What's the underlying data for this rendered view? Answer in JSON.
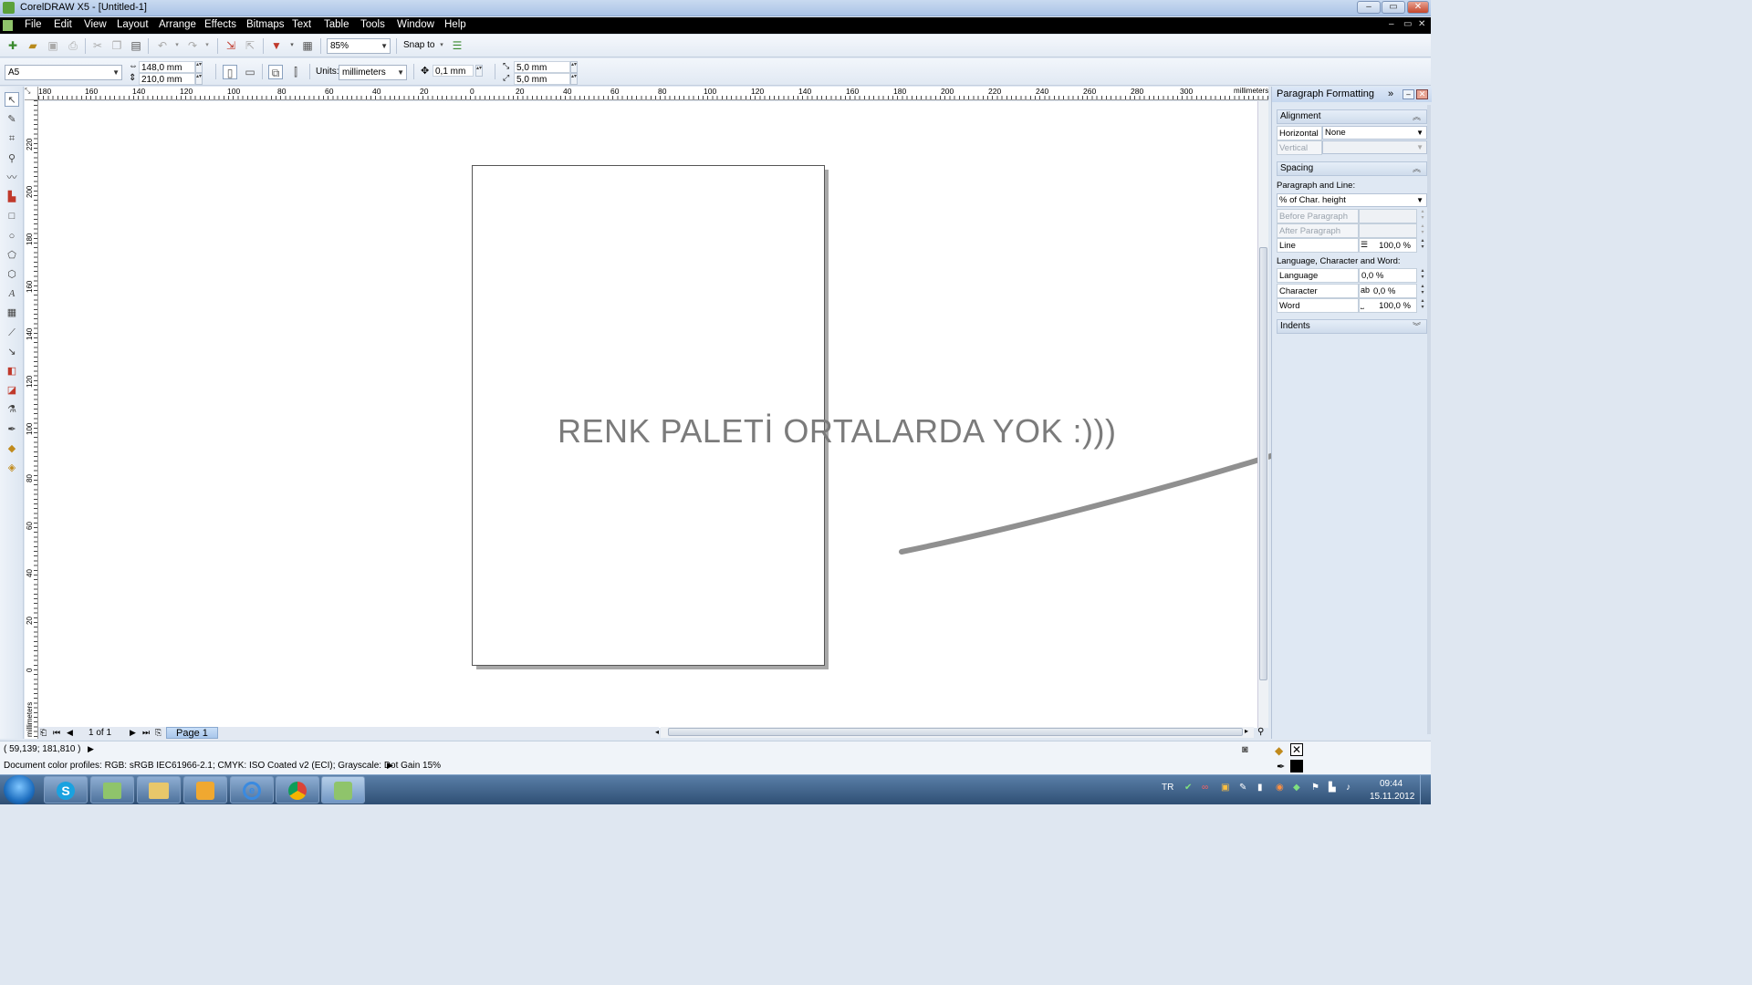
{
  "window": {
    "title": "CorelDRAW X5 - [Untitled-1]",
    "min": "–",
    "max": "▭",
    "close": "✕"
  },
  "menu": [
    "File",
    "Edit",
    "View",
    "Layout",
    "Arrange",
    "Effects",
    "Bitmaps",
    "Text",
    "Table",
    "Tools",
    "Window",
    "Help"
  ],
  "toolbar": {
    "zoom": "85%",
    "snap": "Snap to"
  },
  "property_bar": {
    "paper": "A5",
    "width": "148,0 mm",
    "height": "210,0 mm",
    "units_label": "Units:",
    "units": "millimeters",
    "nudge": "0,1 mm",
    "dup_x": "5,0 mm",
    "dup_y": "5,0 mm"
  },
  "ruler": {
    "h_labels": [
      "180",
      "160",
      "140",
      "120",
      "100",
      "80",
      "60",
      "40",
      "20",
      "0",
      "20",
      "40",
      "60",
      "80",
      "100",
      "120",
      "140",
      "160",
      "180",
      "200",
      "220",
      "240",
      "260",
      "280",
      "300"
    ],
    "h_unit": "millimeters",
    "v_labels": [
      "220",
      "200",
      "180",
      "160",
      "140",
      "120",
      "100",
      "80",
      "60",
      "40",
      "20",
      "0"
    ],
    "v_unit": "millimeters"
  },
  "canvas": {
    "annotation": "RENK PALETİ ORTALARDA YOK :)))"
  },
  "page_nav": {
    "count": "1 of 1",
    "tab": "Page 1"
  },
  "status": {
    "coords": "( 59,139; 181,810 )",
    "profiles": "Document color profiles: RGB: sRGB IEC61966-2.1; CMYK: ISO Coated v2 (ECI); Grayscale: Dot Gain 15%"
  },
  "docker": {
    "title": "Paragraph Formatting",
    "alignment": {
      "title": "Alignment",
      "horizontal_label": "Horizontal",
      "horizontal_value": "None",
      "vertical_label": "Vertical"
    },
    "spacing": {
      "title": "Spacing",
      "para_line_label": "Paragraph and Line:",
      "mode": "% of Char. height",
      "before": "Before Paragraph",
      "after": "After Paragraph",
      "line_label": "Line",
      "line_value": "100,0 %",
      "lcw_label": "Language, Character and Word:",
      "language_label": "Language",
      "language_value": "0,0 %",
      "character_label": "Character",
      "character_value": "0,0 %",
      "word_label": "Word",
      "word_value": "100,0 %"
    },
    "indents": {
      "title": "Indents"
    }
  },
  "taskbar": {
    "lang": "TR",
    "time": "09:44",
    "date": "15.11.2012"
  }
}
